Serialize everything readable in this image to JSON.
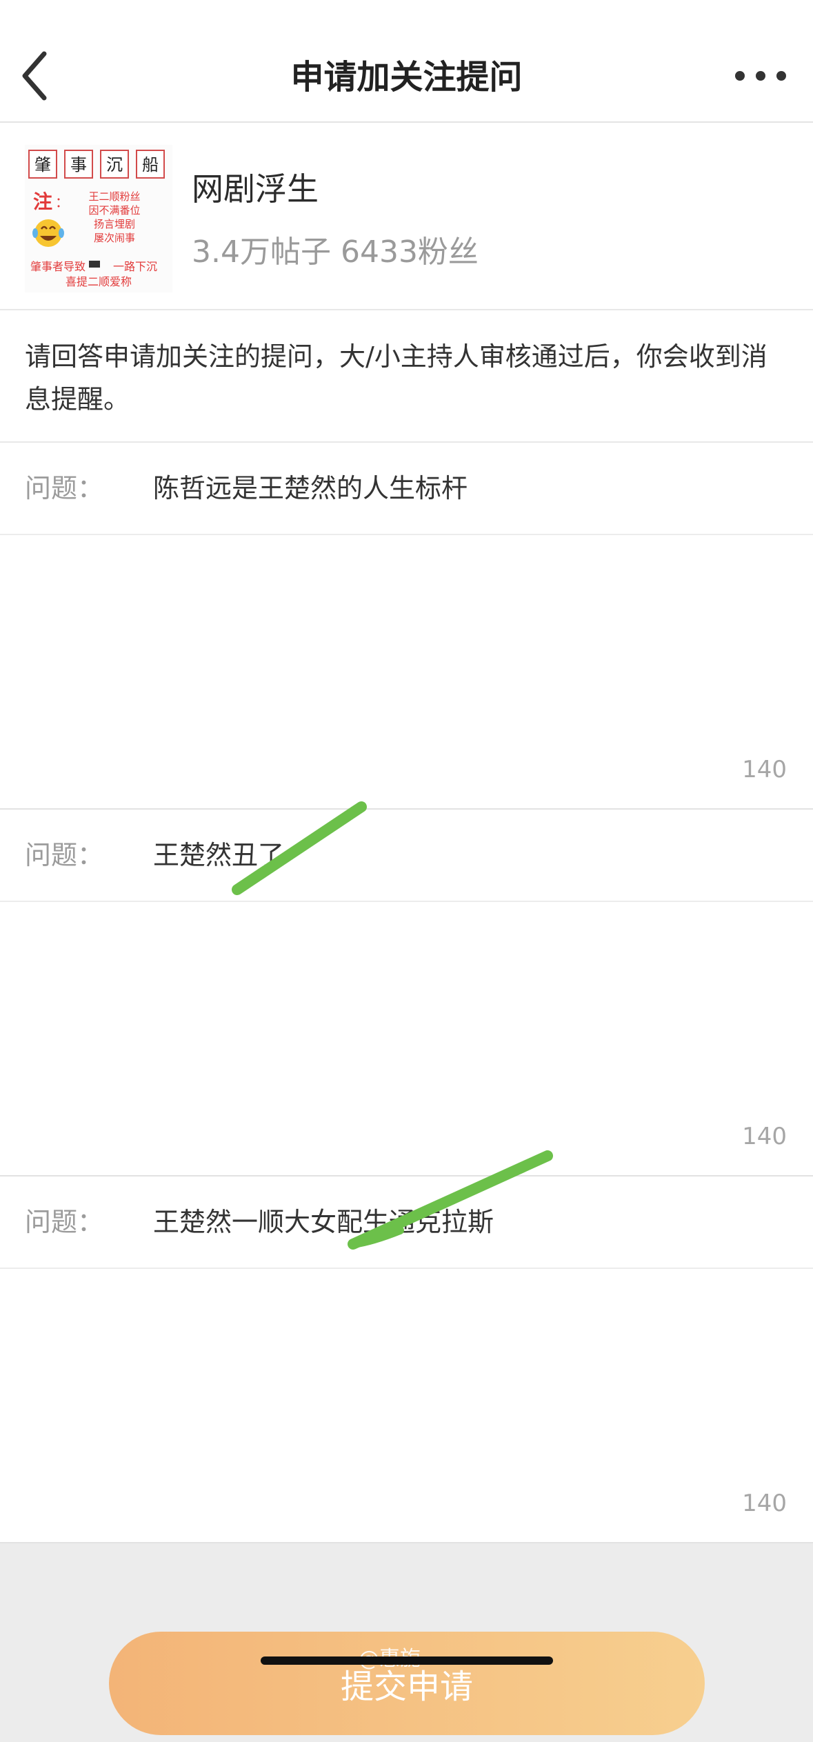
{
  "header": {
    "title": "申请加关注提问"
  },
  "topic": {
    "name": "网剧浮生",
    "stats": "3.4万帖子 6433粉丝",
    "thumbnail": {
      "boxes": [
        "肇",
        "事",
        "沉",
        "船"
      ],
      "note_label": "注",
      "note_colon": "：",
      "note_lines": [
        "王二顺粉丝",
        "因不满番位",
        "扬言埋剧",
        "屡次闹事"
      ],
      "footer_lines": [
        "肇事者导致",
        "一路下沉",
        "喜提二顺爱称"
      ],
      "icon": "laughing-crying-emoji-icon"
    }
  },
  "notice": {
    "text": "请回答申请加关注的提问，大/小主持人审核通过后，你会收到消息提醒。"
  },
  "questions": [
    {
      "label": "问题：",
      "text": "陈哲远是王楚然的人生标杆",
      "counter": "140"
    },
    {
      "label": "问题：",
      "text": "王楚然丑了",
      "counter": "140"
    },
    {
      "label": "问题：",
      "text": "王楚然一顺大女配生通克拉斯",
      "counter": "140"
    }
  ],
  "footer": {
    "submit_label": "提交申请",
    "watermark": "@惠旎"
  },
  "colors": {
    "accent_start": "#f3b477",
    "accent_end": "#f7cf8f",
    "annotation_stroke": "#6cc04a",
    "thumb_red": "#e23b3b"
  }
}
